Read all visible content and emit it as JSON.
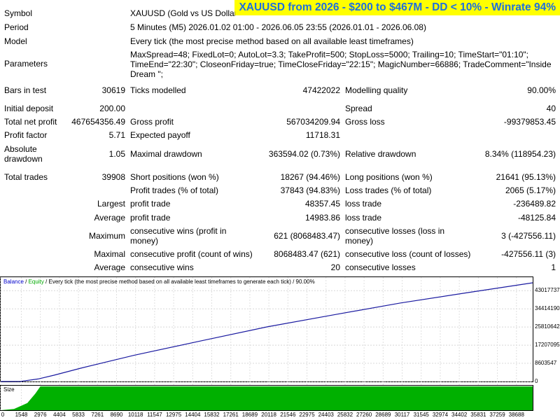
{
  "banner": "XAUUSD from 2026 - $200 to $467M - DD < 10% - Winrate 94%",
  "rows": {
    "symbol_label": "Symbol",
    "symbol_value": "XAUUSD (Gold vs US Dollar)",
    "period_label": "Period",
    "period_value": "5 Minutes (M5) 2026.01.02 01:00 - 2026.06.05 23:55 (2026.01.01 - 2026.06.08)",
    "model_label": "Model",
    "model_value": "Every tick (the most precise method based on all available least timeframes)",
    "parameters_label": "Parameters",
    "parameters_value": "MaxSpread=48; FixedLot=0; AutoLot=3.3; TakeProfit=500; StopLoss=5000; Trailing=10; TimeStart=\"01:10\"; TimeEnd=\"22:30\"; CloseonFriday=true; TimeCloseFriday=\"22:15\"; MagicNumber=66886; TradeComment=\"Inside Dream \";",
    "bars_label": "Bars in test",
    "bars_value": "30619",
    "ticks_label": "Ticks modelled",
    "ticks_value": "47422022",
    "quality_label": "Modelling quality",
    "quality_value": "90.00%",
    "deposit_label": "Initial deposit",
    "deposit_value": "200.00",
    "spread_label": "Spread",
    "spread_value": "40",
    "netprofit_label": "Total net profit",
    "netprofit_value": "467654356.49",
    "grossprofit_label": "Gross profit",
    "grossprofit_value": "567034209.94",
    "grossloss_label": "Gross loss",
    "grossloss_value": "-99379853.45",
    "pf_label": "Profit factor",
    "pf_value": "5.71",
    "payoff_label": "Expected payoff",
    "payoff_value": "11718.31",
    "absdd_label": "Absolute drawdown",
    "absdd_value": "1.05",
    "maxdd_label": "Maximal drawdown",
    "maxdd_value": "363594.02 (0.73%)",
    "reldd_label": "Relative drawdown",
    "reldd_value": "8.34% (118954.23)",
    "trades_label": "Total trades",
    "trades_value": "39908",
    "short_label": "Short positions (won %)",
    "short_value": "18267 (94.46%)",
    "long_label": "Long positions (won %)",
    "long_value": "21641 (95.13%)",
    "pt_label": "Profit trades (% of total)",
    "pt_value": "37843 (94.83%)",
    "lt_label": "Loss trades (% of total)",
    "lt_value": "2065 (5.17%)",
    "largest_label": "Largest",
    "lpt_label": "profit trade",
    "lpt_value": "48357.45",
    "llt_label": "loss trade",
    "llt_value": "-236489.82",
    "average_label": "Average",
    "apt_label": "profit trade",
    "apt_value": "14983.86",
    "alt_label": "loss trade",
    "alt_value": "-48125.84",
    "maximum_label": "Maximum",
    "mcw_label": "consecutive wins (profit in money)",
    "mcw_value": "621 (8068483.47)",
    "mcl_label": "consecutive losses (loss in money)",
    "mcl_value": "3 (-427556.11)",
    "maximal_label": "Maximal",
    "mcp_label": "consecutive profit (count of wins)",
    "mcp_value": "8068483.47 (621)",
    "mclc_label": "consecutive loss (count of losses)",
    "mclc_value": "-427556.11 (3)",
    "average2_label": "Average",
    "acw_label": "consecutive wins",
    "acw_value": "20",
    "acl_label": "consecutive losses",
    "acl_value": "1"
  },
  "chart_title": {
    "balance": "Balance",
    "sep": " / ",
    "equity": "Equity",
    "rest": " / Every tick (the most precise method based on all available least timeframes to generate each tick) / 90.00%"
  },
  "size_label": "Size",
  "colors": {
    "balance_line": "#1a1aa0",
    "size_fill": "#00b000",
    "banner_bg": "#ffff00",
    "banner_text": "#1e6fe0"
  },
  "chart_data": {
    "type": "line",
    "title": "",
    "xlabel": "",
    "ylabel": "",
    "x_ticks": [
      "0",
      "1548",
      "2976",
      "4404",
      "5833",
      "7261",
      "8690",
      "10118",
      "11547",
      "12975",
      "14404",
      "15832",
      "17261",
      "18689",
      "20118",
      "21546",
      "22975",
      "24403",
      "25832",
      "27260",
      "28689",
      "30117",
      "31545",
      "32974",
      "34402",
      "35831",
      "37259",
      "38688"
    ],
    "y_ticks": [
      "0",
      "8603547",
      "17207095",
      "25810642",
      "34414190",
      "43017737"
    ],
    "ylim": [
      0,
      46765435
    ],
    "xlim": [
      0,
      39908
    ],
    "series": [
      {
        "name": "Balance",
        "x": [
          0,
          1500,
          2800,
          4000,
          6000,
          10000,
          15000,
          20000,
          25000,
          30000,
          35000,
          39908
        ],
        "y": [
          200,
          50000,
          1200000,
          3000000,
          6300000,
          12400000,
          19200000,
          25900000,
          31600000,
          37200000,
          42100000,
          46765435
        ]
      }
    ],
    "size_series": {
      "name": "Size",
      "description": "lot size grows from 0 to full by ~trade 2900 then stays at max",
      "x": [
        0,
        1000,
        2000,
        2600,
        2976,
        39908
      ],
      "y": [
        0,
        0.05,
        0.3,
        0.7,
        1,
        1
      ]
    }
  }
}
